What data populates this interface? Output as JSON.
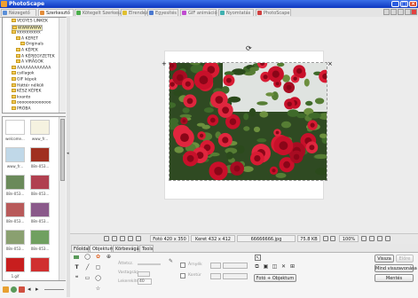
{
  "window": {
    "title": "PhotoScape"
  },
  "tabs": [
    {
      "label": "Nézegető",
      "color": "#5a8fd8"
    },
    {
      "label": "Szerkesztő",
      "color": "#e28c3a"
    },
    {
      "label": "Kötegelt Szerkesztő",
      "color": "#4cae4c"
    },
    {
      "label": "Elrendez",
      "color": "#e0c030"
    },
    {
      "label": "Egyesítés",
      "color": "#4a78d0"
    },
    {
      "label": "GIF animáció",
      "color": "#c04ad0"
    },
    {
      "label": "Nyomtatás",
      "color": "#3fb0b0"
    },
    {
      "label": "PhotoScape",
      "color": "#d04040"
    }
  ],
  "tree": {
    "items": [
      {
        "label": "VEGYES LINKEK",
        "indent": 2
      },
      {
        "label": "WWWWWW",
        "indent": 2,
        "selected": true
      },
      {
        "label": "xxxxxxxxxx",
        "indent": 2
      },
      {
        "label": "A KERET",
        "indent": 3
      },
      {
        "label": "Originals",
        "indent": 4
      },
      {
        "label": "A KÉPEK",
        "indent": 3
      },
      {
        "label": "A KÉPJEGYZETEK",
        "indent": 3
      },
      {
        "label": "A VIRÁGOK",
        "indent": 3
      },
      {
        "label": "AAAAAAAAAAAA",
        "indent": 2
      },
      {
        "label": "csillagok",
        "indent": 2
      },
      {
        "label": "GIF képek",
        "indent": 2
      },
      {
        "label": "Háttér nélküli",
        "indent": 2
      },
      {
        "label": "KÉSZ KÉPEK",
        "indent": 2
      },
      {
        "label": "kvanto",
        "indent": 2
      },
      {
        "label": "oooooooooooooo",
        "indent": 2
      },
      {
        "label": "PRÓBA",
        "indent": 2
      }
    ]
  },
  "thumbnails": [
    {
      "caption": "welcome...",
      "tone": "#ffffff"
    },
    {
      "caption": "www_fr...",
      "tone": "#f5f2e0"
    },
    {
      "caption": "www_fr...",
      "tone": "#c0d8e8"
    },
    {
      "caption": "08n-053...",
      "tone": "#a03020"
    },
    {
      "caption": "08n-053...",
      "tone": "#6a8a5a"
    },
    {
      "caption": "08n-053...",
      "tone": "#b04050"
    },
    {
      "caption": "08n-053...",
      "tone": "#b85a5a"
    },
    {
      "caption": "08n-053...",
      "tone": "#8a5a8a"
    },
    {
      "caption": "08n-053...",
      "tone": "#8aa070"
    },
    {
      "caption": "08n-053...",
      "tone": "#70a060"
    },
    {
      "caption": "1.gif",
      "tone": "#c81e1e"
    },
    {
      "caption": "",
      "tone": "#d03030"
    }
  ],
  "status": {
    "photo_size": "Fotó 420 x 350",
    "frame_size": "Keret 432 x 412",
    "filename": "66666666.jpg",
    "file_size": "75.8 KB",
    "zoom": "100%"
  },
  "bottom": {
    "tabs": [
      "Főoldal",
      "Objektum",
      "Körbevágás",
      "Tools"
    ],
    "active_tab": 1,
    "labels": {
      "opacity": "Áttetsz.",
      "size": "Vastagság",
      "line": "Lekerekítés",
      "shadow": "Árnyék",
      "outline": "Kontúr"
    },
    "counter": "40",
    "photo_object_button": "Fotó + Objektum",
    "undo": "Vissza",
    "redo": "Előre",
    "undo_all": "Mind visszavonása",
    "save": "Mentés"
  },
  "icons": [
    "minimize-icon",
    "maximize-icon",
    "close-icon",
    "folder-icon",
    "zoom-in-icon",
    "zoom-out-icon",
    "rotate-icon",
    "flip-icon"
  ]
}
